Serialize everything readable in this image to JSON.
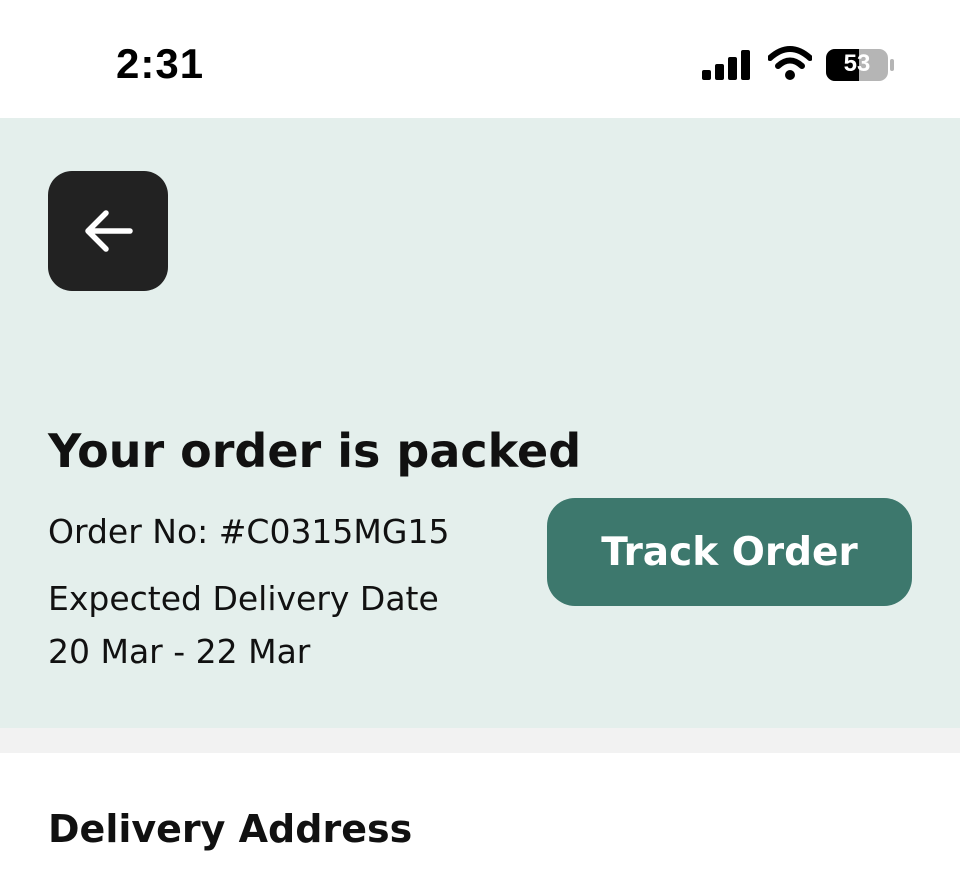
{
  "status_bar": {
    "time": "2:31",
    "battery_level": "53",
    "icons": [
      "cellular-signal-icon",
      "wifi-icon",
      "battery-icon"
    ]
  },
  "header": {
    "back_icon": "arrow-left-icon"
  },
  "order": {
    "title": "Your order is packed",
    "order_number": "Order No: #C0315MG15",
    "delivery_label": "Expected Delivery Date",
    "delivery_range": "20 Mar - 22 Mar",
    "track_button_label": "Track Order"
  },
  "delivery_address": {
    "heading": "Delivery Address"
  },
  "colors": {
    "panel_background": "#e4efec",
    "accent": "#3d786d",
    "back_button": "#222222",
    "divider": "#f2f2f2"
  }
}
